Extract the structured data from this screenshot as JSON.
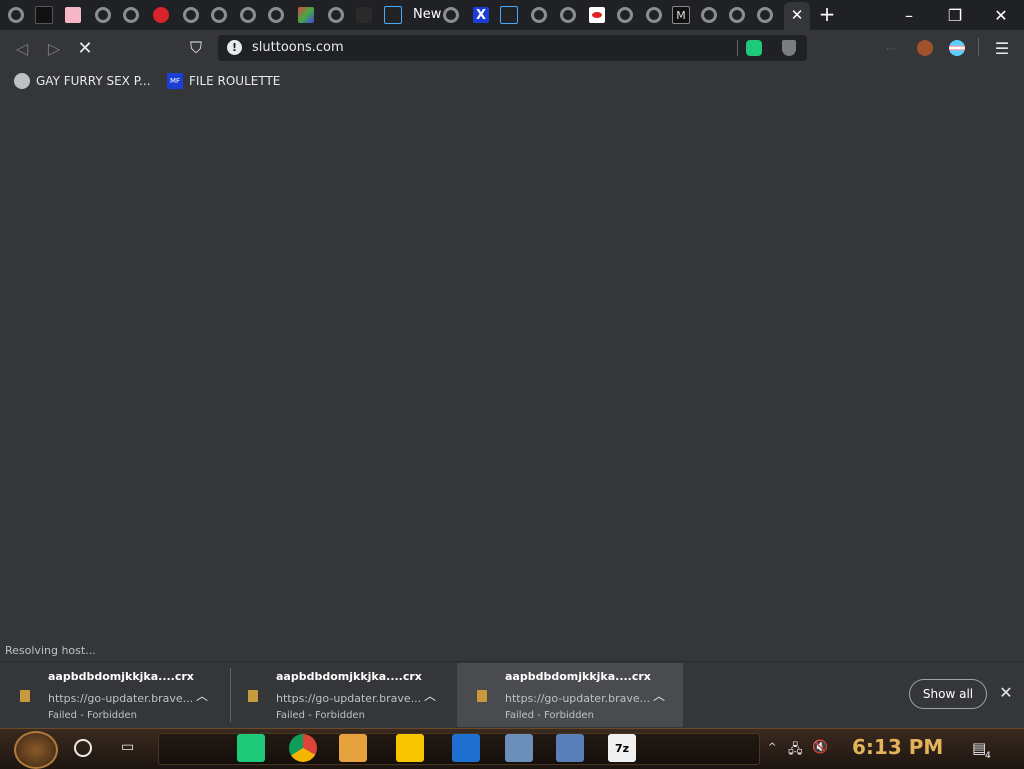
{
  "browser": {
    "new_tab_text": "New",
    "url": "sluttoons.com",
    "status_text": "Resolving host..."
  },
  "tabs": {
    "icons": [
      "globe-icon",
      "mf-icon",
      "pink-thumb-icon",
      "globe-icon",
      "wuf-icon",
      "globe-icon",
      "globe-icon",
      "globe-icon",
      "globe-icon",
      "colorful-thumb-icon",
      "globe-icon",
      "dark-thumb-icon",
      "porn-icon",
      "new-tab-text",
      "globe-icon",
      "x-icon",
      "porn-icon",
      "globe-icon",
      "globe-icon",
      "lips-icon",
      "globe-icon",
      "globe-icon",
      "m-icon",
      "globe-icon",
      "globe-icon",
      "globe-icon"
    ]
  },
  "bookmarks": [
    {
      "label": "GAY FURRY SEX P..."
    },
    {
      "label": "FILE ROULETTE"
    }
  ],
  "downloads": [
    {
      "name": "aapbdbdomjkkjka....crx",
      "url": "https://go-updater.brave...",
      "status": "Failed - Forbidden"
    },
    {
      "name": "aapbdbdomjkkjka....crx",
      "url": "https://go-updater.brave...",
      "status": "Failed - Forbidden"
    },
    {
      "name": "aapbdbdomjkkjka....crx",
      "url": "https://go-updater.brave...",
      "status": "Failed - Forbidden"
    }
  ],
  "shelf": {
    "show_all": "Show all"
  },
  "taskbar": {
    "clock": "6:13 PM",
    "notification_count": "4"
  },
  "colors": {
    "tabstrip_bg": "#202124",
    "toolbar_bg": "#35363a",
    "clock": "#e3b35a"
  }
}
